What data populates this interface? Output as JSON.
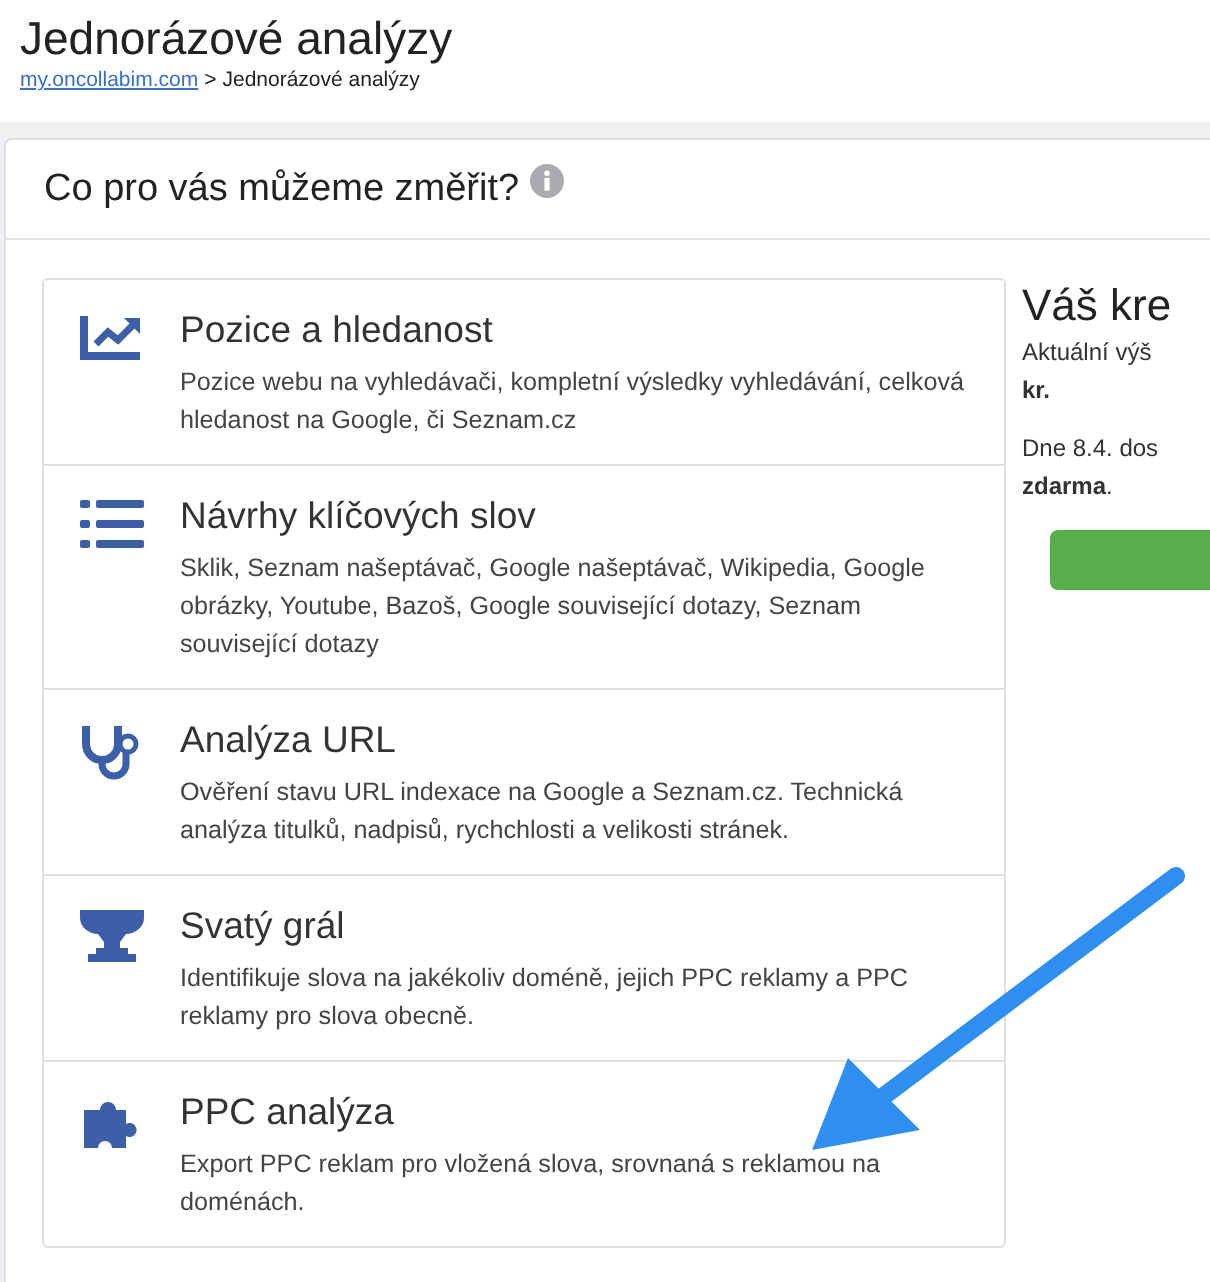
{
  "page": {
    "title": "Jednorázové analýzy",
    "breadcrumb": {
      "link": "my.oncollabim.com",
      "separator": ">",
      "current": "Jednorázové analýzy"
    }
  },
  "card": {
    "heading": "Co pro vás můžeme změřit?",
    "analyses": [
      {
        "kind": "chart",
        "title": "Pozice a hledanost",
        "description": "Pozice webu na vyhledávači, kompletní výsledky vyhledávání, celková hledanost na Google, či Seznam.cz"
      },
      {
        "kind": "list",
        "title": "Návrhy klíčových slov",
        "description": "Sklik, Seznam našeptávač, Google našeptávač, Wikipedia, Google obrázky, Youtube, Bazoš, Google související dotazy, Seznam související dotazy"
      },
      {
        "kind": "stethoscope",
        "title": "Analýza URL",
        "description": "Ověření stavu URL indexace na Google a Seznam.cz. Technická analýza titulků, nadpisů, rychchlosti a velikosti stránek."
      },
      {
        "kind": "trophy",
        "title": "Svatý grál",
        "description": "Identifikuje slova na jakékoliv doméně, jejich PPC reklamy a PPC reklamy pro slova obecně."
      },
      {
        "kind": "puzzle",
        "title": "PPC analýza",
        "description": "Export PPC reklam pro vložená slova, srovnaná s reklamou na doménách."
      }
    ],
    "credit": {
      "heading": "Váš kre",
      "line1": "Aktuální výš",
      "line1_bold": "kr.",
      "line2": "Dne 8.4. dos",
      "line2_bold": "zdarma",
      "line2_end": "."
    }
  }
}
